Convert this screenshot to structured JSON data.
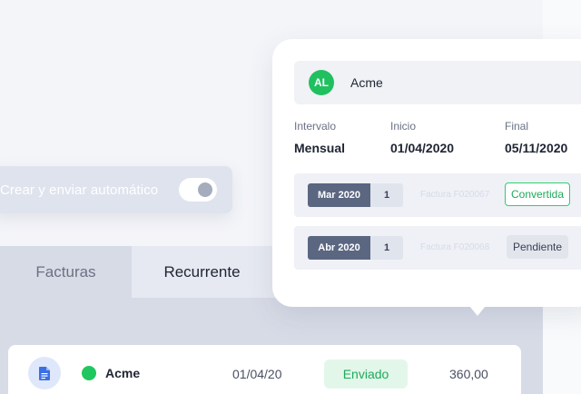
{
  "toggle": {
    "label": "Crear y enviar automático",
    "enabled": true
  },
  "tabs": [
    {
      "label": "Facturas",
      "active": false
    },
    {
      "label": "Recurrente",
      "active": true
    }
  ],
  "list_row": {
    "icon": "document-icon",
    "client": "Acme",
    "date": "01/04/20",
    "status": "Enviado",
    "amount": "360,00"
  },
  "card": {
    "client": {
      "initials": "AL",
      "name": "Acme"
    },
    "interval": {
      "label": "Intervalo",
      "value": "Mensual"
    },
    "start": {
      "label": "Inicio",
      "value": "01/04/2020"
    },
    "end": {
      "label": "Final",
      "value": "05/11/2020"
    },
    "invoices": [
      {
        "month": "Mar 2020",
        "count": "1",
        "ref": "Factura F020067",
        "status": "Convertida"
      },
      {
        "month": "Abr 2020",
        "count": "1",
        "ref": "Factura F020068",
        "status": "Pendiente"
      }
    ]
  },
  "colors": {
    "accent_green": "#20c060",
    "status_blue_gray": "#5b6681",
    "background": "#f4f5f9"
  }
}
